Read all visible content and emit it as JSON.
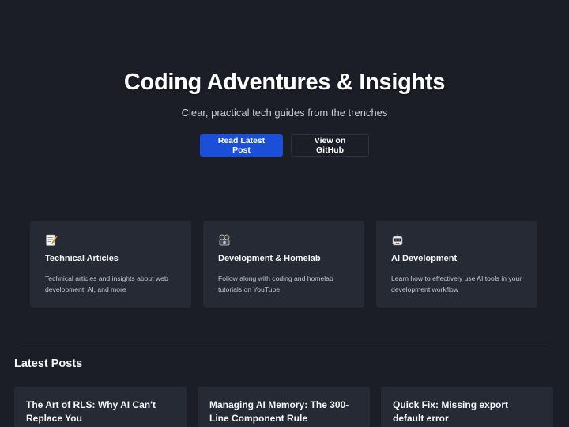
{
  "hero": {
    "title": "Coding Adventures & Insights",
    "subtitle": "Clear, practical tech guides from the trenches",
    "primary_button": "Read Latest Post",
    "secondary_button": "View on GitHub"
  },
  "features": [
    {
      "icon": "memo-icon",
      "title": "Technical Articles",
      "description": "Technical articles and insights about web development, AI, and more"
    },
    {
      "icon": "film-projector-icon",
      "title": "Development & Homelab",
      "description": "Follow along with coding and homelab tutorials on YouTube"
    },
    {
      "icon": "robot-icon",
      "title": "AI Development",
      "description": "Learn how to effectively use AI tools in your development workflow"
    }
  ],
  "latest": {
    "heading": "Latest Posts",
    "posts": [
      {
        "title": "The Art of RLS: Why AI Can't Replace You"
      },
      {
        "title": "Managing AI Memory: The 300-Line Component Rule"
      },
      {
        "title": "Quick Fix: Missing export default error"
      }
    ]
  },
  "colors": {
    "background": "#1b1e27",
    "card": "#262a35",
    "accent": "#1d4ed8"
  }
}
